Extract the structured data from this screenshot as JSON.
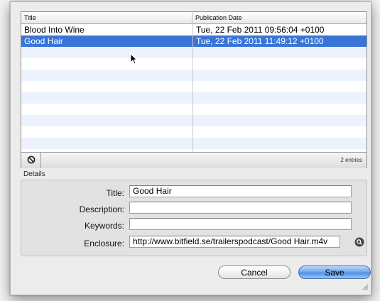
{
  "table": {
    "columns": [
      "Title",
      "Publication Date"
    ],
    "rows": [
      {
        "title": "Blood Into Wine",
        "date": "Tue, 22 Feb 2011 09:56:04 +0100",
        "selected": false
      },
      {
        "title": "Good Hair",
        "date": "Tue, 22 Feb 2011 11:49:12 +0100",
        "selected": true
      }
    ],
    "count_label": "2 entries",
    "remove_icon": "no-entry-icon"
  },
  "details": {
    "section_label": "Details",
    "fields": [
      {
        "label": "Title:",
        "value": ""
      },
      {
        "label": "Description:",
        "value": ""
      },
      {
        "label": "Keywords:",
        "value": ""
      },
      {
        "label": "Enclosure:",
        "value": ""
      }
    ],
    "title_value": "Good Hair",
    "enclosure_value": "http://www.bitfield.se/trailerspodcast/Good Hair.m4v",
    "reveal_icon": "magnifier-icon"
  },
  "buttons": {
    "cancel_label": "Cancel",
    "save_label": "Save"
  },
  "colors": {
    "selection": "#3875d7",
    "stripe": "#edf3fe",
    "save_button": "#6fa6ec"
  }
}
